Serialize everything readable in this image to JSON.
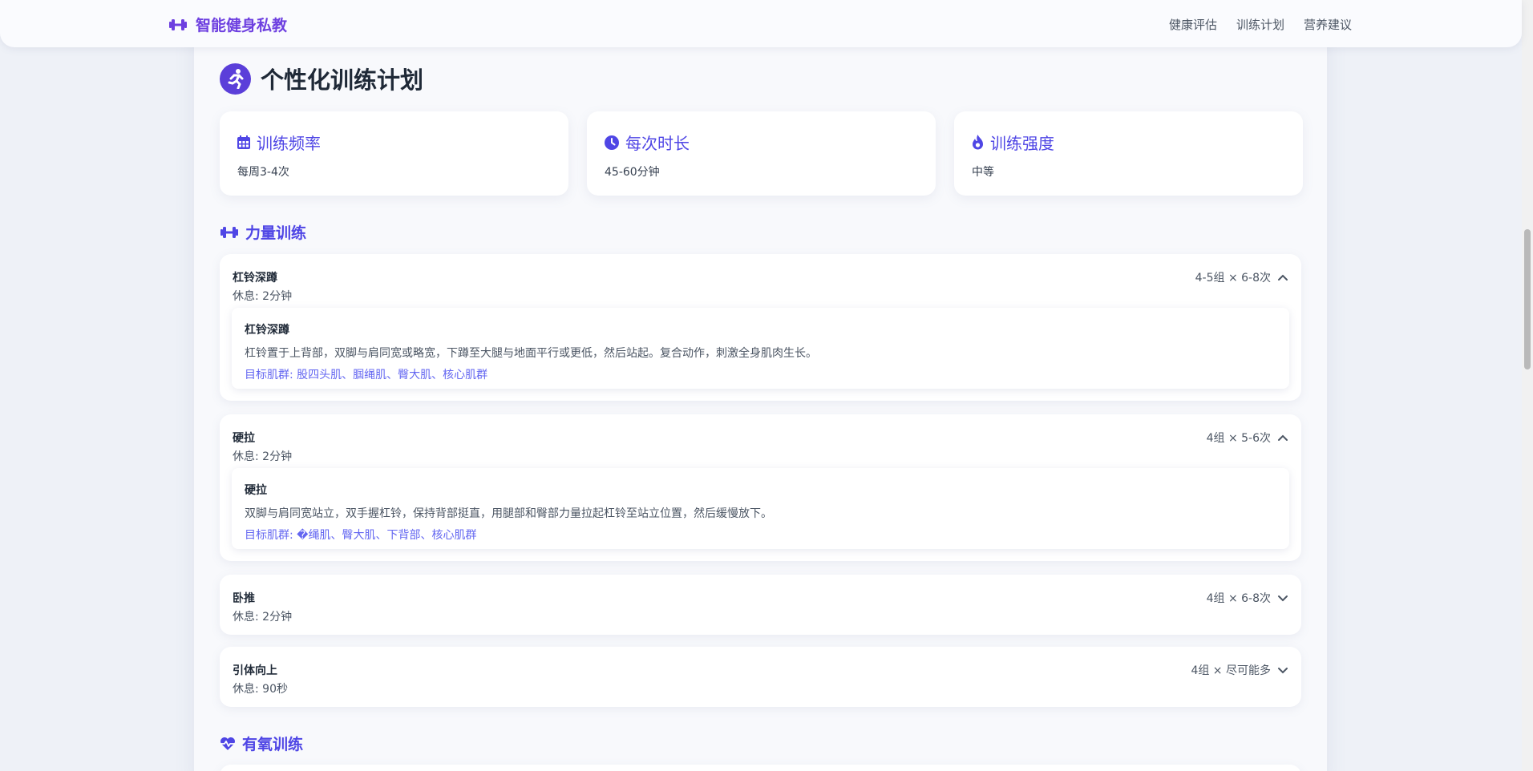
{
  "nav": {
    "brand": "智能健身私教",
    "links": [
      "健康评估",
      "训练计划",
      "营养建议"
    ]
  },
  "page": {
    "title": "个性化训练计划"
  },
  "stats": [
    {
      "label": "训练频率",
      "value": "每周3-4次",
      "icon": "calendar-icon"
    },
    {
      "label": "每次时长",
      "value": "45-60分钟",
      "icon": "clock-icon"
    },
    {
      "label": "训练强度",
      "value": "中等",
      "icon": "fire-icon"
    }
  ],
  "sections": {
    "strength": "力量训练",
    "cardio": "有氧训练"
  },
  "exercises": [
    {
      "name": "杠铃深蹲",
      "rest": "休息: 2分钟",
      "sets": "4-5组 × 6-8次",
      "expanded": true,
      "detail_name": "杠铃深蹲",
      "description": "杠铃置于上背部，双脚与肩同宽或略宽，下蹲至大腿与地面平行或更低，然后站起。复合动作，刺激全身肌肉生长。",
      "target": "目标肌群: 股四头肌、腘绳肌、臀大肌、核心肌群"
    },
    {
      "name": "硬拉",
      "rest": "休息: 2分钟",
      "sets": "4组 × 5-6次",
      "expanded": true,
      "detail_name": "硬拉",
      "description": "双脚与肩同宽站立，双手握杠铃，保持背部挺直，用腿部和臀部力量拉起杠铃至站立位置，然后缓慢放下。",
      "target": "目标肌群: �绳肌、臀大肌、下背部、核心肌群"
    },
    {
      "name": "卧推",
      "rest": "休息: 2分钟",
      "sets": "4组 × 6-8次",
      "expanded": false
    },
    {
      "name": "引体向上",
      "rest": "休息: 90秒",
      "sets": "4组 × 尽可能多",
      "expanded": false
    }
  ],
  "colors": {
    "accent": "#4f46e5",
    "brand": "#6d3fe0"
  }
}
